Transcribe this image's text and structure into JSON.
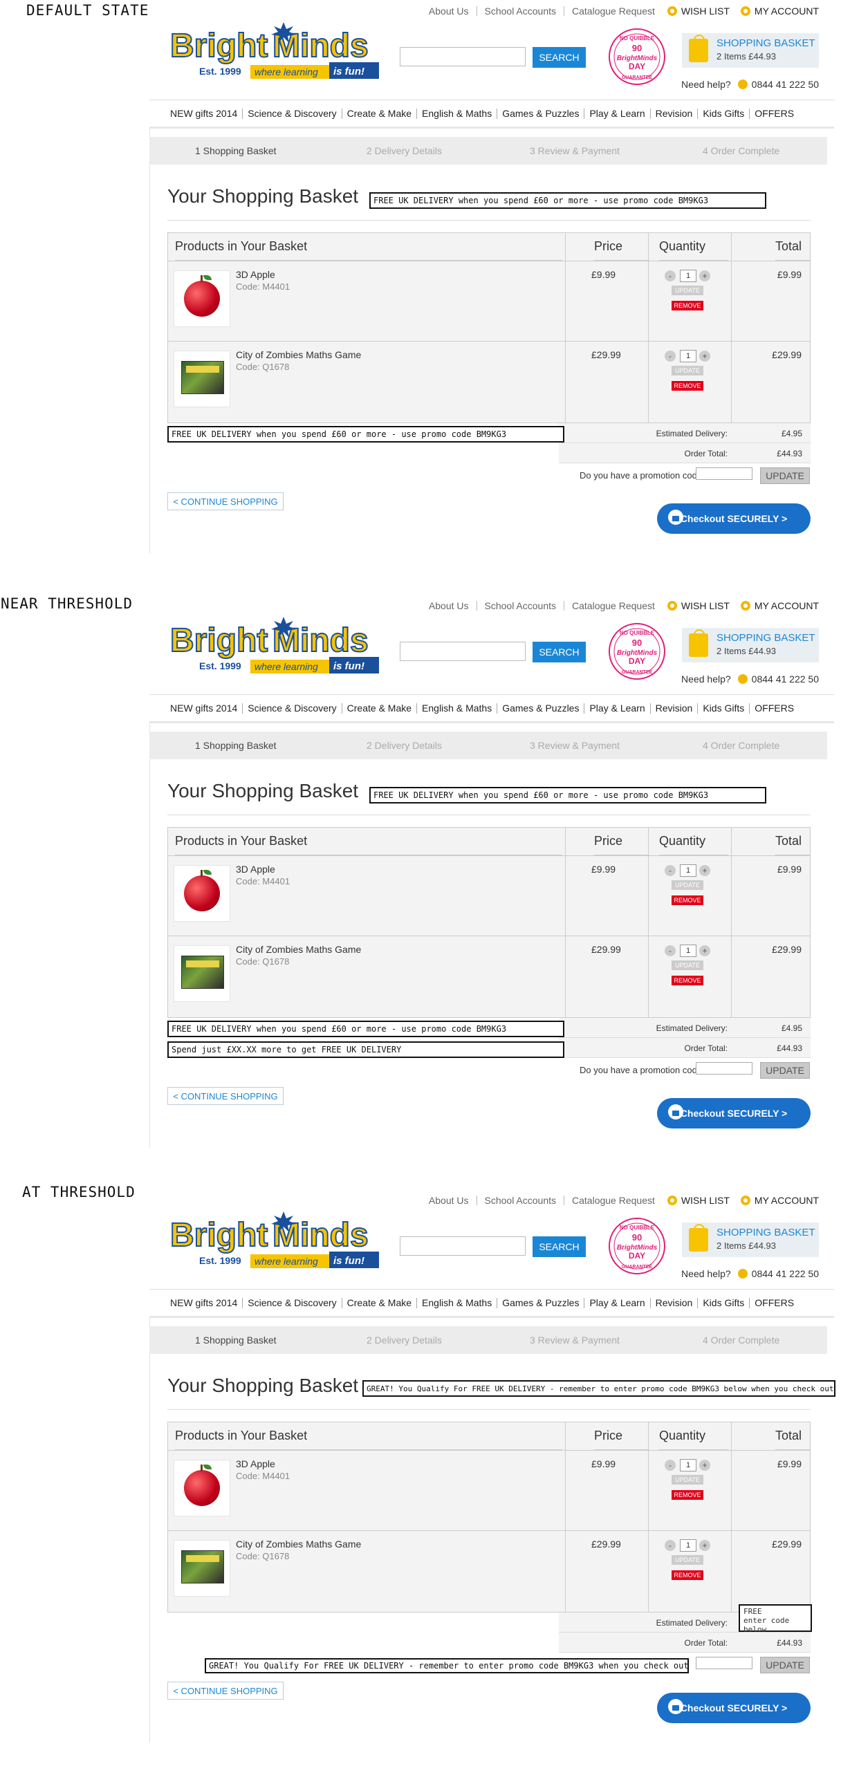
{
  "nav": {
    "about": "About Us",
    "school": "School Accounts",
    "catalogue": "Catalogue Request",
    "wishlist": "WISH LIST",
    "account": "MY ACCOUNT"
  },
  "brand": {
    "name1": "Bright",
    "name2": "Minds",
    "est": "Est. 1999",
    "tagline": "where learning",
    "tagline2": "is fun!",
    "primary": "#1a87d6",
    "accent": "#f6c400"
  },
  "stamp": {
    "top": "NO QUIBBLE",
    "num": "90",
    "mid": "BrightMinds",
    "day": "DAY",
    "bottom": "GUARANTEE"
  },
  "search": {
    "button": "SEARCH",
    "placeholder": ""
  },
  "basket": {
    "title": "SHOPPING BASKET",
    "items": "2 Items £44.93"
  },
  "help": {
    "label": "Need help?",
    "phone": "0844 41 222 50"
  },
  "categories": [
    "NEW gifts 2014",
    "Science & Discovery",
    "Create & Make",
    "English & Maths",
    "Games & Puzzles",
    "Play & Learn",
    "Revision",
    "Kids Gifts",
    "OFFERS"
  ],
  "steps": [
    "1 Shopping Basket",
    "2 Delivery Details",
    "3 Review & Payment",
    "4 Order Complete"
  ],
  "page_title": "Your Shopping Basket",
  "table": {
    "headers": {
      "products": "Products in Your Basket",
      "price": "Price",
      "quantity": "Quantity",
      "total": "Total"
    },
    "rows": [
      {
        "name": "3D Apple",
        "code": "Code: M4401",
        "price": "£9.99",
        "qty": "1",
        "total": "£9.99"
      },
      {
        "name": "City of Zombies Maths Game",
        "code": "Code: Q1678",
        "price": "£29.99",
        "qty": "1",
        "total": "£29.99"
      }
    ],
    "update": "UPDATE",
    "remove": "REMOVE",
    "minus": "-",
    "plus": "+"
  },
  "summary": {
    "delivery_label": "Estimated Delivery:",
    "delivery_value": "£4.95",
    "total_label": "Order Total:",
    "total_value": "£44.93"
  },
  "promo": {
    "question": "Do you have a promotion code?",
    "update": "UPDATE"
  },
  "continue": "< CONTINUE SHOPPING",
  "checkout": "Checkout SECURELY >",
  "states": [
    {
      "label": "DEFAULT STATE",
      "title_msg": "FREE UK DELIVERY when you spend £60 or more - use promo code BM9KG3",
      "row_msg": "FREE UK DELIVERY when you spend £60 or more - use promo code BM9KG3"
    },
    {
      "label": "NEAR THRESHOLD",
      "title_msg": "FREE UK DELIVERY when you spend £60 or more - use promo code BM9KG3",
      "row_msg": "FREE UK DELIVERY when you spend £60 or more - use promo code BM9KG3",
      "near_msg": "Spend just £XX.XX more to get FREE UK DELIVERY"
    },
    {
      "label": "AT THRESHOLD",
      "title_msg": "GREAT! You Qualify For FREE UK DELIVERY - remember to enter promo code BM9KG3 below when you check out",
      "free_line1": "FREE",
      "free_line2": "enter code below",
      "promo_line_msg": "GREAT! You Qualify For FREE UK DELIVERY - remember to enter promo code BM9KG3 when you check out here >>>>"
    }
  ]
}
